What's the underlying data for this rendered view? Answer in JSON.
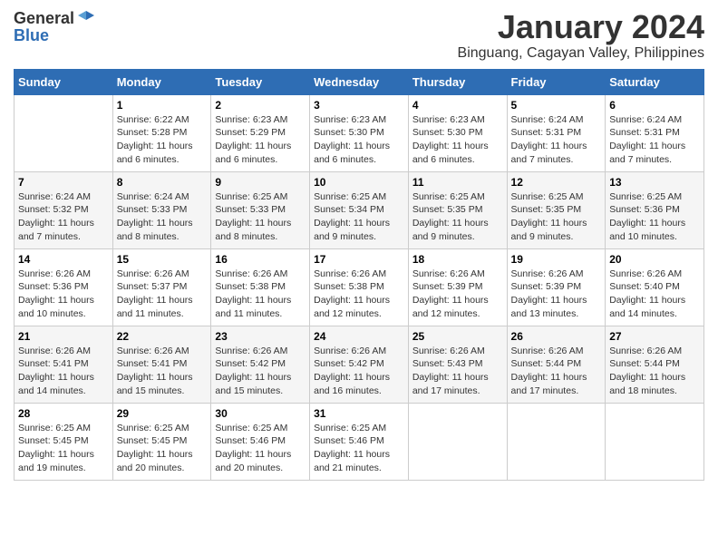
{
  "header": {
    "logo_general": "General",
    "logo_blue": "Blue",
    "month_title": "January 2024",
    "subtitle": "Binguang, Cagayan Valley, Philippines"
  },
  "weekdays": [
    "Sunday",
    "Monday",
    "Tuesday",
    "Wednesday",
    "Thursday",
    "Friday",
    "Saturday"
  ],
  "weeks": [
    [
      {
        "day": "",
        "text": ""
      },
      {
        "day": "1",
        "text": "Sunrise: 6:22 AM\nSunset: 5:28 PM\nDaylight: 11 hours\nand 6 minutes."
      },
      {
        "day": "2",
        "text": "Sunrise: 6:23 AM\nSunset: 5:29 PM\nDaylight: 11 hours\nand 6 minutes."
      },
      {
        "day": "3",
        "text": "Sunrise: 6:23 AM\nSunset: 5:30 PM\nDaylight: 11 hours\nand 6 minutes."
      },
      {
        "day": "4",
        "text": "Sunrise: 6:23 AM\nSunset: 5:30 PM\nDaylight: 11 hours\nand 6 minutes."
      },
      {
        "day": "5",
        "text": "Sunrise: 6:24 AM\nSunset: 5:31 PM\nDaylight: 11 hours\nand 7 minutes."
      },
      {
        "day": "6",
        "text": "Sunrise: 6:24 AM\nSunset: 5:31 PM\nDaylight: 11 hours\nand 7 minutes."
      }
    ],
    [
      {
        "day": "7",
        "text": "Sunrise: 6:24 AM\nSunset: 5:32 PM\nDaylight: 11 hours\nand 7 minutes."
      },
      {
        "day": "8",
        "text": "Sunrise: 6:24 AM\nSunset: 5:33 PM\nDaylight: 11 hours\nand 8 minutes."
      },
      {
        "day": "9",
        "text": "Sunrise: 6:25 AM\nSunset: 5:33 PM\nDaylight: 11 hours\nand 8 minutes."
      },
      {
        "day": "10",
        "text": "Sunrise: 6:25 AM\nSunset: 5:34 PM\nDaylight: 11 hours\nand 9 minutes."
      },
      {
        "day": "11",
        "text": "Sunrise: 6:25 AM\nSunset: 5:35 PM\nDaylight: 11 hours\nand 9 minutes."
      },
      {
        "day": "12",
        "text": "Sunrise: 6:25 AM\nSunset: 5:35 PM\nDaylight: 11 hours\nand 9 minutes."
      },
      {
        "day": "13",
        "text": "Sunrise: 6:25 AM\nSunset: 5:36 PM\nDaylight: 11 hours\nand 10 minutes."
      }
    ],
    [
      {
        "day": "14",
        "text": "Sunrise: 6:26 AM\nSunset: 5:36 PM\nDaylight: 11 hours\nand 10 minutes."
      },
      {
        "day": "15",
        "text": "Sunrise: 6:26 AM\nSunset: 5:37 PM\nDaylight: 11 hours\nand 11 minutes."
      },
      {
        "day": "16",
        "text": "Sunrise: 6:26 AM\nSunset: 5:38 PM\nDaylight: 11 hours\nand 11 minutes."
      },
      {
        "day": "17",
        "text": "Sunrise: 6:26 AM\nSunset: 5:38 PM\nDaylight: 11 hours\nand 12 minutes."
      },
      {
        "day": "18",
        "text": "Sunrise: 6:26 AM\nSunset: 5:39 PM\nDaylight: 11 hours\nand 12 minutes."
      },
      {
        "day": "19",
        "text": "Sunrise: 6:26 AM\nSunset: 5:39 PM\nDaylight: 11 hours\nand 13 minutes."
      },
      {
        "day": "20",
        "text": "Sunrise: 6:26 AM\nSunset: 5:40 PM\nDaylight: 11 hours\nand 14 minutes."
      }
    ],
    [
      {
        "day": "21",
        "text": "Sunrise: 6:26 AM\nSunset: 5:41 PM\nDaylight: 11 hours\nand 14 minutes."
      },
      {
        "day": "22",
        "text": "Sunrise: 6:26 AM\nSunset: 5:41 PM\nDaylight: 11 hours\nand 15 minutes."
      },
      {
        "day": "23",
        "text": "Sunrise: 6:26 AM\nSunset: 5:42 PM\nDaylight: 11 hours\nand 15 minutes."
      },
      {
        "day": "24",
        "text": "Sunrise: 6:26 AM\nSunset: 5:42 PM\nDaylight: 11 hours\nand 16 minutes."
      },
      {
        "day": "25",
        "text": "Sunrise: 6:26 AM\nSunset: 5:43 PM\nDaylight: 11 hours\nand 17 minutes."
      },
      {
        "day": "26",
        "text": "Sunrise: 6:26 AM\nSunset: 5:44 PM\nDaylight: 11 hours\nand 17 minutes."
      },
      {
        "day": "27",
        "text": "Sunrise: 6:26 AM\nSunset: 5:44 PM\nDaylight: 11 hours\nand 18 minutes."
      }
    ],
    [
      {
        "day": "28",
        "text": "Sunrise: 6:25 AM\nSunset: 5:45 PM\nDaylight: 11 hours\nand 19 minutes."
      },
      {
        "day": "29",
        "text": "Sunrise: 6:25 AM\nSunset: 5:45 PM\nDaylight: 11 hours\nand 20 minutes."
      },
      {
        "day": "30",
        "text": "Sunrise: 6:25 AM\nSunset: 5:46 PM\nDaylight: 11 hours\nand 20 minutes."
      },
      {
        "day": "31",
        "text": "Sunrise: 6:25 AM\nSunset: 5:46 PM\nDaylight: 11 hours\nand 21 minutes."
      },
      {
        "day": "",
        "text": ""
      },
      {
        "day": "",
        "text": ""
      },
      {
        "day": "",
        "text": ""
      }
    ]
  ]
}
